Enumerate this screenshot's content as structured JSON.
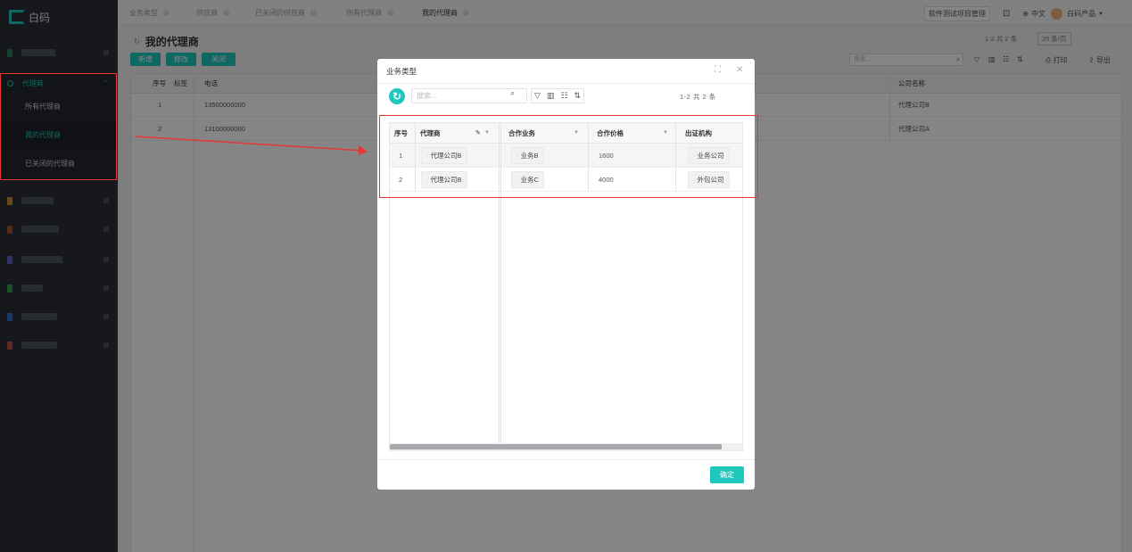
{
  "app": {
    "brand": "白码"
  },
  "sidebar": {
    "blur_item_colors": [
      "#2e7d5b",
      "#c0902a",
      "#a0522d",
      "#5b5fc7",
      "#2e9e4f",
      "#3a6ad4",
      "#c94a4a"
    ],
    "agent_menu": {
      "label": "代理商",
      "items": [
        {
          "label": "所有代理商"
        },
        {
          "label": "我的代理商"
        },
        {
          "label": "已关闭的代理商"
        }
      ]
    }
  },
  "tabs": [
    {
      "label": "业务类型"
    },
    {
      "label": "供应商"
    },
    {
      "label": "已关闭的供应商"
    },
    {
      "label": "所有代理商"
    },
    {
      "label": "我的代理商"
    }
  ],
  "topbar": {
    "project": "软件测试项目管理",
    "lang": "中文",
    "product": "白码产品"
  },
  "page": {
    "title": "我的代理商",
    "buttons": {
      "add": "新增",
      "edit": "修改",
      "close": "关闭"
    },
    "pager": "1-2 共 2 条",
    "page_size": "20 条/页",
    "search_placeholder": "搜索...",
    "print_label": "打印",
    "export_label": "导出",
    "columns": {
      "index": "序号",
      "tag": "标签",
      "phone": "电话",
      "company": "公司名称"
    },
    "rows": [
      {
        "index": "1",
        "phone": "13500000000",
        "company": "代理公司B"
      },
      {
        "index": "2",
        "phone": "13100000000",
        "company": "代理公司A"
      }
    ]
  },
  "modal": {
    "title": "业务类型",
    "search_placeholder": "搜索...",
    "pager": "1-2 共 2 条",
    "columns": {
      "index": "序号",
      "agent": "代理商",
      "business": "合作业务",
      "price": "合作价格",
      "org": "出证机构"
    },
    "rows": [
      {
        "index": "1",
        "agent": "代理公司B",
        "business": "业务B",
        "price": "1600",
        "org": "业务公司"
      },
      {
        "index": "2",
        "agent": "代理公司B",
        "business": "业务C",
        "price": "4000",
        "org": "外包公司"
      }
    ],
    "ok_label": "确定"
  },
  "annotation_color": "#e53935"
}
